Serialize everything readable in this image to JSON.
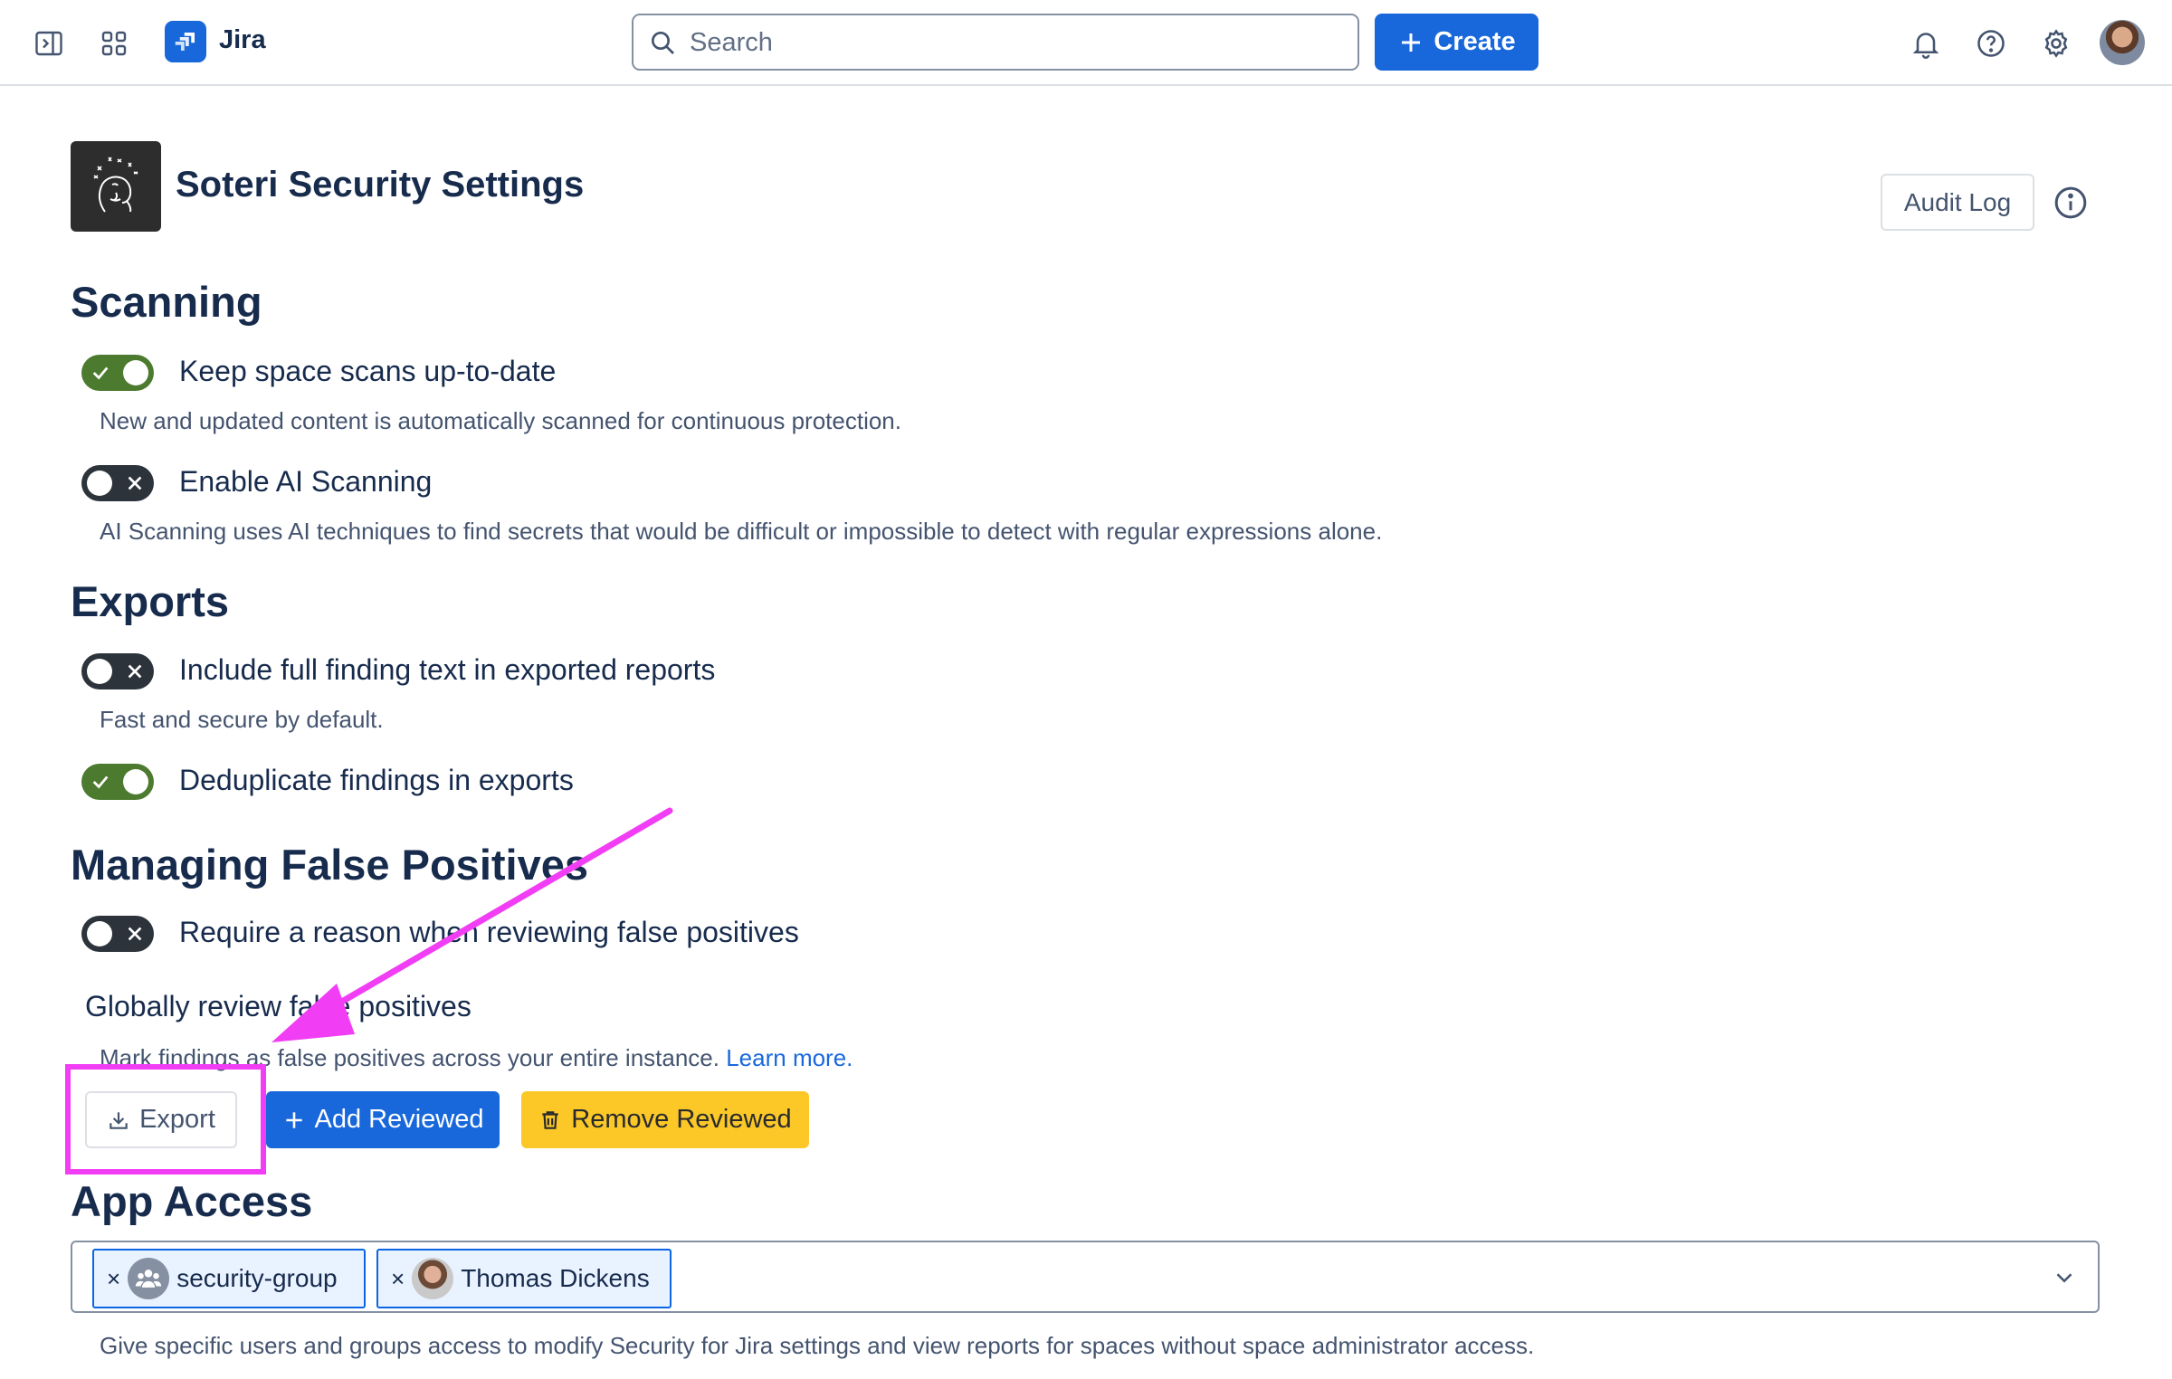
{
  "topbar": {
    "app_name": "Jira",
    "search_placeholder": "Search",
    "create_label": "Create",
    "icons": [
      "sidebar-toggle-icon",
      "app-switcher-icon",
      "bell-icon",
      "help-icon",
      "gear-icon"
    ]
  },
  "header": {
    "title": "Soteri Security Settings",
    "audit_log_label": "Audit Log"
  },
  "scanning": {
    "heading": "Scanning",
    "options": [
      {
        "label": "Keep space scans up-to-date",
        "enabled": true,
        "description": "New and updated content is automatically scanned for continuous protection."
      },
      {
        "label": "Enable AI Scanning",
        "enabled": false,
        "description": "AI Scanning uses AI techniques to find secrets that would be difficult or impossible to detect with regular expressions alone."
      }
    ]
  },
  "exports": {
    "heading": "Exports",
    "options": [
      {
        "label": "Include full finding text in exported reports",
        "enabled": false,
        "description": "Fast and secure by default."
      },
      {
        "label": "Deduplicate findings in exports",
        "enabled": true
      }
    ]
  },
  "false_positives": {
    "heading": "Managing False Positives",
    "require_reason": {
      "label": "Require a reason when reviewing false positives",
      "enabled": false
    },
    "global_review": {
      "label": "Globally review false positives",
      "description": "Mark findings as false positives across your entire instance.",
      "learn_more": "Learn more."
    },
    "buttons": {
      "export": "Export",
      "add_reviewed": "Add Reviewed",
      "remove_reviewed": "Remove Reviewed"
    }
  },
  "app_access": {
    "heading": "App Access",
    "chips": [
      {
        "remove": "×",
        "label": "security-group",
        "type": "group"
      },
      {
        "remove": "×",
        "label": "Thomas Dickens",
        "type": "user"
      }
    ],
    "description": "Give specific users and groups access to modify Security for Jira settings and view reports for spaces without space administrator access."
  },
  "colors": {
    "primary": "#1868db",
    "toggle_on": "#4c7a2e",
    "toggle_off": "#2c333a",
    "warning_button": "#fbc828",
    "annotation": "#f13ef5"
  }
}
